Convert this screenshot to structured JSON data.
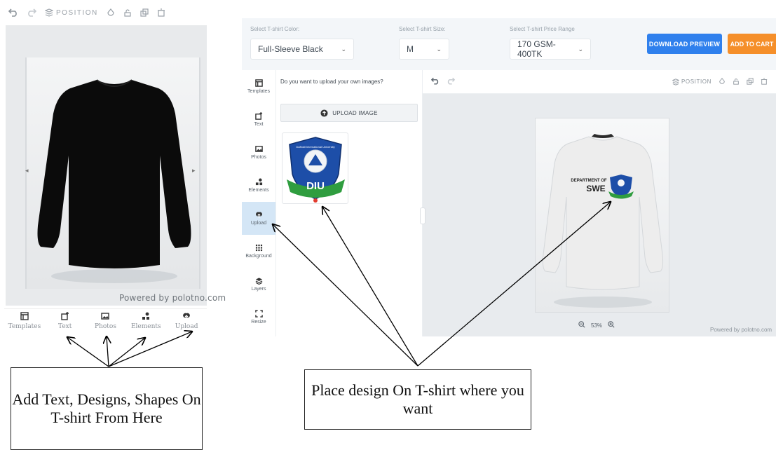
{
  "left_panel": {
    "toolbar": {
      "undo_icon": "undo-icon",
      "redo_icon": "redo-icon",
      "position_label": "POSITION",
      "icons": [
        "layers-icon",
        "opacity-icon",
        "lock-icon",
        "duplicate-icon",
        "delete-icon"
      ]
    },
    "tshirt_color": "#0b0b0b",
    "powered_by": "Powered by polotno.com",
    "bottom_nav": [
      {
        "label": "Templates",
        "icon": "templates-icon"
      },
      {
        "label": "Text",
        "icon": "text-icon"
      },
      {
        "label": "Photos",
        "icon": "photos-icon"
      },
      {
        "label": "Elements",
        "icon": "elements-icon"
      },
      {
        "label": "Upload",
        "icon": "upload-icon"
      }
    ]
  },
  "app": {
    "selectors": {
      "color": {
        "label": "Select T-shirt Color:",
        "value": "Full-Sleeve Black"
      },
      "size": {
        "label": "Select T-shirt Size:",
        "value": "M"
      },
      "price": {
        "label": "Select T-shirt Price Range",
        "value": "170 GSM-400TK"
      }
    },
    "buttons": {
      "download": "DOWNLOAD PREVIEW",
      "cart": "ADD TO CART"
    },
    "colors": {
      "download": "#2f80ed",
      "cart": "#f58f2a",
      "active_tab": "#d4e6f6"
    },
    "sidebar": [
      {
        "label": "Templates",
        "icon": "templates-icon",
        "active": false
      },
      {
        "label": "Text",
        "icon": "text-icon",
        "active": false
      },
      {
        "label": "Photos",
        "icon": "photos-icon",
        "active": false
      },
      {
        "label": "Elements",
        "icon": "elements-icon",
        "active": false
      },
      {
        "label": "Upload",
        "icon": "upload-icon",
        "active": true
      },
      {
        "label": "Background",
        "icon": "background-icon",
        "active": false
      },
      {
        "label": "Layers",
        "icon": "layers-icon",
        "active": false
      },
      {
        "label": "Resize",
        "icon": "resize-icon",
        "active": false
      }
    ],
    "upload_panel": {
      "question": "Do you want to upload your own images?",
      "upload_button": "UPLOAD IMAGE",
      "thumbnail": {
        "logo_text": "Daffodil International University",
        "letters": "DIU"
      }
    },
    "workspace": {
      "position_label": "POSITION",
      "design_text_line1": "DEPARTMENT OF",
      "design_text_line2": "SWE",
      "tshirt_color": "#eeeeee",
      "zoom": "53%",
      "powered_by": "Powered by polotno.com"
    }
  },
  "callouts": {
    "left": "Add Text, Designs, Shapes On T-shirt From Here",
    "right": "Place design On T-shirt where you want"
  }
}
